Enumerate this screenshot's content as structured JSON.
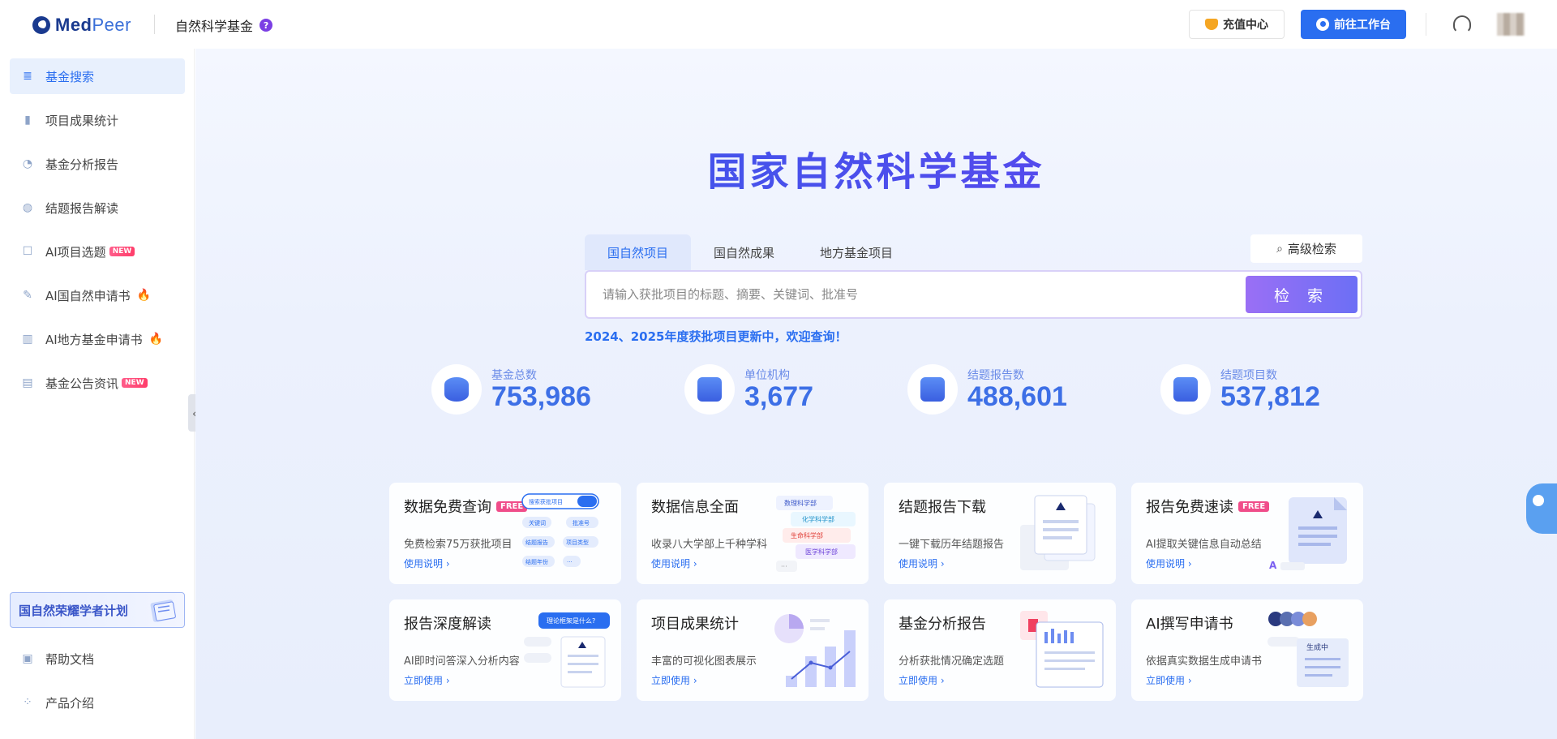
{
  "header": {
    "logo_text_a": "Med",
    "logo_text_b": "Peer",
    "title": "自然科学基金",
    "help_badge": "?",
    "recharge_label": "充值中心",
    "workspace_label": "前往工作台"
  },
  "sidebar": {
    "items": [
      {
        "label": "基金搜索",
        "icon": "search-list-icon",
        "glyph": "≣"
      },
      {
        "label": "项目成果统计",
        "icon": "bar-chart-icon",
        "glyph": "▮"
      },
      {
        "label": "基金分析报告",
        "icon": "pie-chart-icon",
        "glyph": "◔"
      },
      {
        "label": "结题报告解读",
        "icon": "report-icon",
        "glyph": "◍"
      },
      {
        "label": "AI项目选题",
        "icon": "ai-topic-icon",
        "glyph": "☐",
        "badge": "NEW"
      },
      {
        "label": "AI国自然申请书",
        "icon": "feather-icon",
        "glyph": "✎",
        "fire": "🔥"
      },
      {
        "label": "AI地方基金申请书",
        "icon": "ai-chart-icon",
        "glyph": "▥",
        "fire": "🔥"
      },
      {
        "label": "基金公告资讯",
        "icon": "news-icon",
        "glyph": "▤",
        "badge": "NEW"
      }
    ],
    "promo_label": "国自然荣耀学者计划",
    "help_docs": "帮助文档",
    "product_intro": "产品介绍",
    "collapse_glyph": "‹"
  },
  "main": {
    "hero_title": "国家自然科学基金",
    "tabs": [
      "国自然项目",
      "国自然成果",
      "地方基金项目"
    ],
    "advanced_search": "高级检索",
    "search_placeholder": "请输入获批项目的标题、摘要、关键词、批准号",
    "search_button": "检 索",
    "notice": "2024、2025年度获批项目更新中，欢迎查询！",
    "stats": [
      {
        "label": "基金总数",
        "value": "753,986"
      },
      {
        "label": "单位机构",
        "value": "3,677"
      },
      {
        "label": "结题报告数",
        "value": "488,601"
      },
      {
        "label": "结题项目数",
        "value": "537,812"
      }
    ],
    "cards": [
      {
        "title": "数据免费查询",
        "badge": "FREE",
        "desc": "免费检索75万获批项目",
        "link": "使用说明 ›",
        "art": {
          "search_text": "搜索获批项目",
          "tags": [
            "关键词",
            "批准号",
            "结题报告",
            "项目类型",
            "结题年份",
            "···"
          ]
        }
      },
      {
        "title": "数据信息全面",
        "badge": "",
        "desc": "收录八大学部上千种学科",
        "link": "使用说明 ›",
        "art": {
          "tags": [
            "数理科学部",
            "化学科学部",
            "生命科学部",
            "医学科学部",
            "···"
          ]
        }
      },
      {
        "title": "结题报告下载",
        "badge": "",
        "desc": "一键下载历年结题报告",
        "link": "使用说明 ›",
        "art": {}
      },
      {
        "title": "报告免费速读",
        "badge": "FREE",
        "desc": "AI提取关键信息自动总结",
        "link": "使用说明 ›",
        "art": {}
      },
      {
        "title": "报告深度解读",
        "badge": "",
        "desc": "AI即时问答深入分析内容",
        "link": "立即使用 ›",
        "art": {
          "bubble": "理论框架是什么?"
        }
      },
      {
        "title": "项目成果统计",
        "badge": "",
        "desc": "丰富的可视化图表展示",
        "link": "立即使用 ›",
        "art": {}
      },
      {
        "title": "基金分析报告",
        "badge": "",
        "desc": "分析获批情况确定选题",
        "link": "立即使用 ›",
        "art": {}
      },
      {
        "title": "AI撰写申请书",
        "badge": "",
        "desc": "依据真实数据生成申请书",
        "link": "立即使用 ›",
        "art": {
          "status": "生成中"
        }
      }
    ]
  },
  "colors": {
    "accent": "#2a6ef0",
    "hero_start": "#2e5ee8",
    "hero_end": "#6a3ff0",
    "free": "#f04d8a"
  }
}
